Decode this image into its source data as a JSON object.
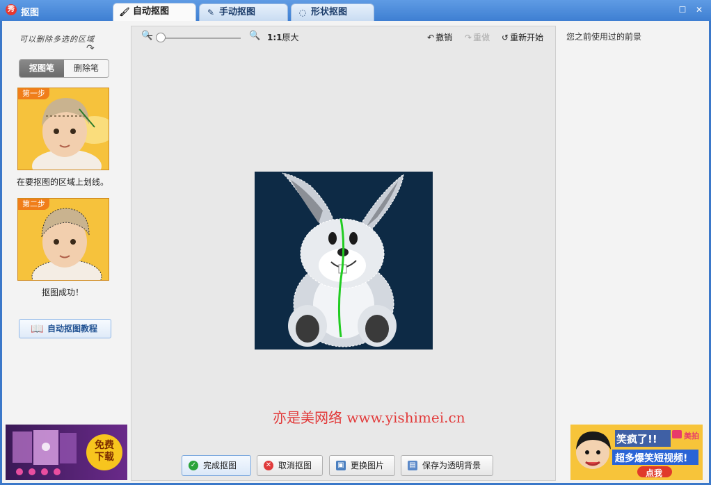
{
  "window": {
    "title": "抠图",
    "logo_text": "秀"
  },
  "tabs": [
    {
      "label": "自动抠图",
      "icon": "brush-icon"
    },
    {
      "label": "手动抠图",
      "icon": "magic-pen-icon"
    },
    {
      "label": "形状抠图",
      "icon": "shape-icon"
    }
  ],
  "left": {
    "hint": "可以删除多选的区域",
    "pen_toggle": {
      "active": "抠图笔",
      "inactive": "删除笔"
    },
    "step1": {
      "badge": "第一步",
      "caption": "在要抠图的区域上划线。"
    },
    "step2": {
      "badge": "第二步",
      "caption": "抠图成功！"
    },
    "tutorial_button": "自动抠图教程",
    "ad": {
      "text": "免费\n下载"
    }
  },
  "toolbar": {
    "ratio_bold": "1:1",
    "ratio_text": "原大",
    "undo": "撤销",
    "redo": "重做",
    "restart": "重新开始"
  },
  "watermark": "亦是美网络 www.yishimei.cn",
  "bottom_buttons": {
    "done": "完成抠图",
    "cancel": "取消抠图",
    "change": "更换图片",
    "save": "保存为透明背景"
  },
  "right": {
    "label": "您之前使用过的前景",
    "ad": {
      "headline": "笑疯了!!",
      "subline": "超多爆笑短视频!",
      "brand": "美拍",
      "cta": "点我"
    }
  },
  "colors": {
    "accent": "#3e7fd2",
    "watermark": "#e23a3a",
    "canvas_bg": "#0d2a45",
    "stroke": "#22cc22"
  }
}
